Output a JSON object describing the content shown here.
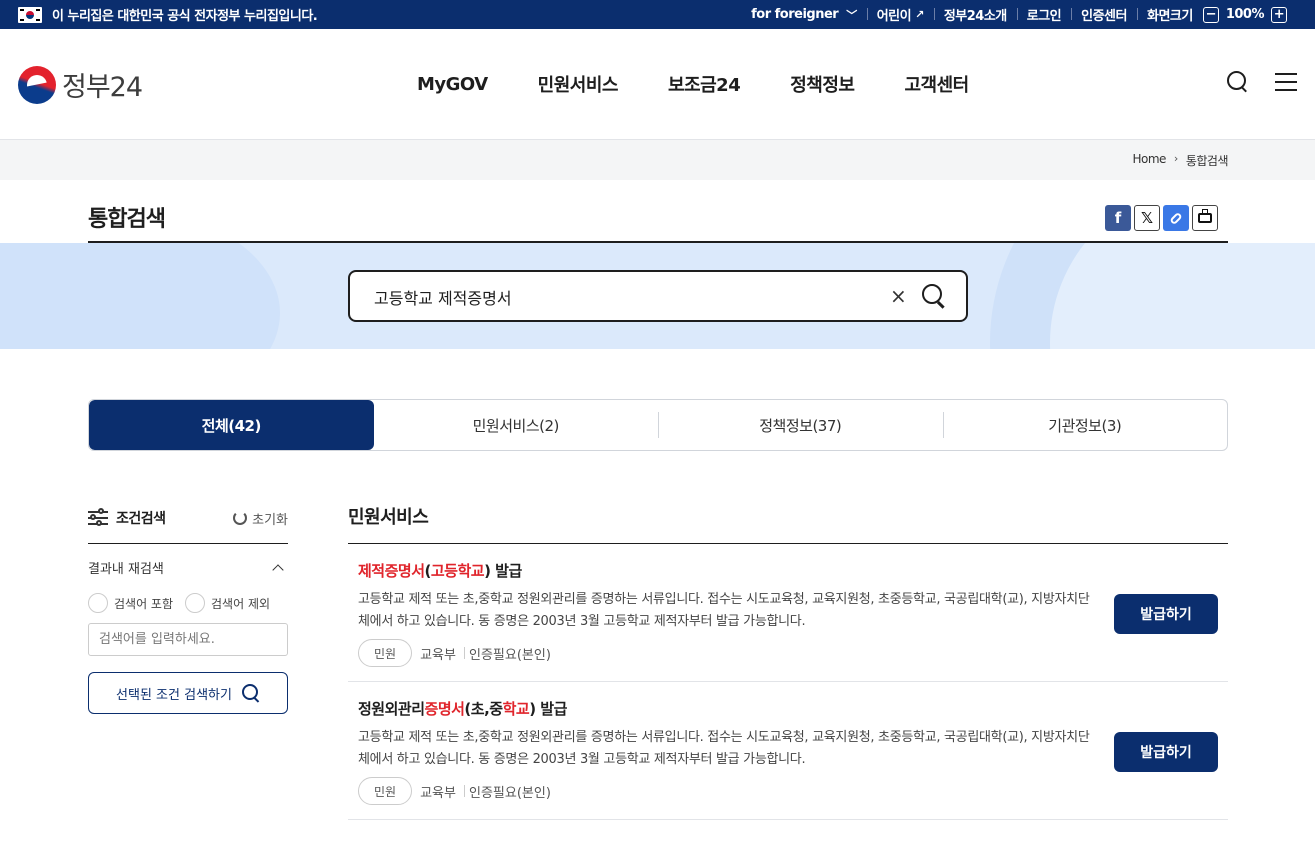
{
  "topbar": {
    "notice": "이 누리집은 대한민국 공식 전자정부 누리집입니다.",
    "foreigner": "for foreigner",
    "kids": "어린이",
    "about": "정부24소개",
    "login": "로그인",
    "cert": "인증센터",
    "screen_size": "화면크기",
    "zoom_minus": "−",
    "zoom": "100%",
    "zoom_plus": "+"
  },
  "header": {
    "logo": "정부24",
    "nav": [
      "MyGOV",
      "민원서비스",
      "보조금24",
      "정책정보",
      "고객센터"
    ]
  },
  "breadcrumb": {
    "home": "Home",
    "sep": "›",
    "current": "통합검색"
  },
  "page": {
    "title": "통합검색"
  },
  "share": {
    "facebook": "f",
    "x": "𝕏",
    "link": "🔗",
    "print": "⎙"
  },
  "search": {
    "value": "고등학교 제적증명서",
    "clear": "×"
  },
  "tabs": [
    "전체(42)",
    "민원서비스(2)",
    "정책정보(37)",
    "기관정보(3)"
  ],
  "filter": {
    "title": "조건검색",
    "reset": "초기화",
    "sub": "결과내 재검색",
    "include": "검색어 포함",
    "exclude": "검색어 제외",
    "placeholder": "검색어를 입력하세요.",
    "submit": "선택된 조건 검색하기"
  },
  "results": {
    "section_title": "민원서비스",
    "items": [
      {
        "title_parts": [
          "제적증명서",
          "(",
          "고등학교",
          ") 발급"
        ],
        "desc": "고등학교 제적 또는 초,중학교 정원외관리를 증명하는 서류입니다. 접수는 시도교육청, 교육지원청, 초중등학교, 국공립대학(교), 지방자치단체에서 하고 있습니다. 동 증명은 2003년 3월 고등학교 제적자부터 발급 가능합니다.",
        "tag": "민원",
        "org": "교육부",
        "auth": "인증필요(본인)",
        "button": "발급하기"
      },
      {
        "title_parts": [
          "정원외관리",
          "증명서",
          "(초,중",
          "학교",
          ") 발급"
        ],
        "desc": "고등학교 제적 또는 초,중학교 정원외관리를 증명하는 서류입니다. 접수는 시도교육청, 교육지원청, 초중등학교, 국공립대학(교), 지방자치단체에서 하고 있습니다. 동 증명은 2003년 3월 고등학교 제적자부터 발급 가능합니다.",
        "tag": "민원",
        "org": "교육부",
        "auth": "인증필요(본인)",
        "button": "발급하기"
      }
    ]
  },
  "colors": {
    "brand_navy": "#0b2e6e",
    "highlight_red": "#e0242b",
    "band_blue": "#dbe9fb"
  }
}
